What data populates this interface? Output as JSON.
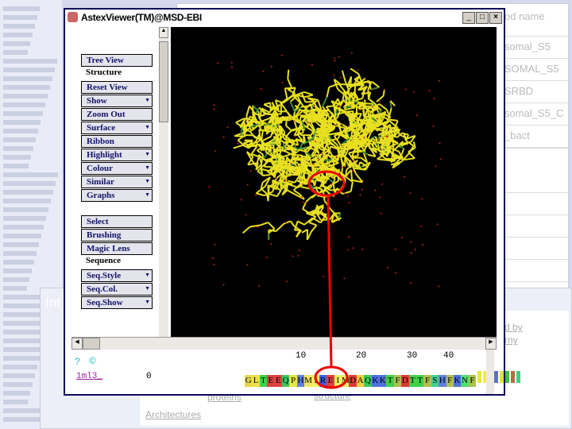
{
  "window": {
    "title": "AstexViewer(TM)@MSD-EBI"
  },
  "menu": {
    "buttons": [
      {
        "label": "Tree View",
        "dropdown": false
      },
      {
        "label": "Reset View",
        "dropdown": false
      },
      {
        "label": "Show",
        "dropdown": true
      },
      {
        "label": "Zoom Out",
        "dropdown": false
      },
      {
        "label": "Surface",
        "dropdown": true
      },
      {
        "label": "Ribbon",
        "dropdown": false
      },
      {
        "label": "Highlight",
        "dropdown": true
      },
      {
        "label": "Colour",
        "dropdown": true
      },
      {
        "label": "Similar",
        "dropdown": true
      },
      {
        "label": "Graphs",
        "dropdown": true
      },
      {
        "label": "Select",
        "dropdown": false
      },
      {
        "label": "Brushing",
        "dropdown": false
      },
      {
        "label": "Magic Lens",
        "dropdown": false
      },
      {
        "label": "Seq.Style",
        "dropdown": true
      },
      {
        "label": "Seq.Col.",
        "dropdown": true
      },
      {
        "label": "Seq.Show",
        "dropdown": true
      }
    ],
    "section_structure": "Structure",
    "section_sequence": "Sequence"
  },
  "sequence": {
    "chain": "1ml3_",
    "start": "0",
    "ticks": [
      "10",
      "20",
      "30",
      "40"
    ],
    "residues": "GLTEEQPHMIREIMDAQKKTFDTTFSHFKNF"
  },
  "background_page": {
    "column_header": "od name",
    "rows": [
      "somal_S5",
      "SOMAL_S5",
      "SRBD",
      "somal_S5_C",
      "_bact"
    ],
    "heading": "Int",
    "links": [
      "proteins",
      "structure",
      "Architectures",
      "d by",
      "rny"
    ]
  }
}
